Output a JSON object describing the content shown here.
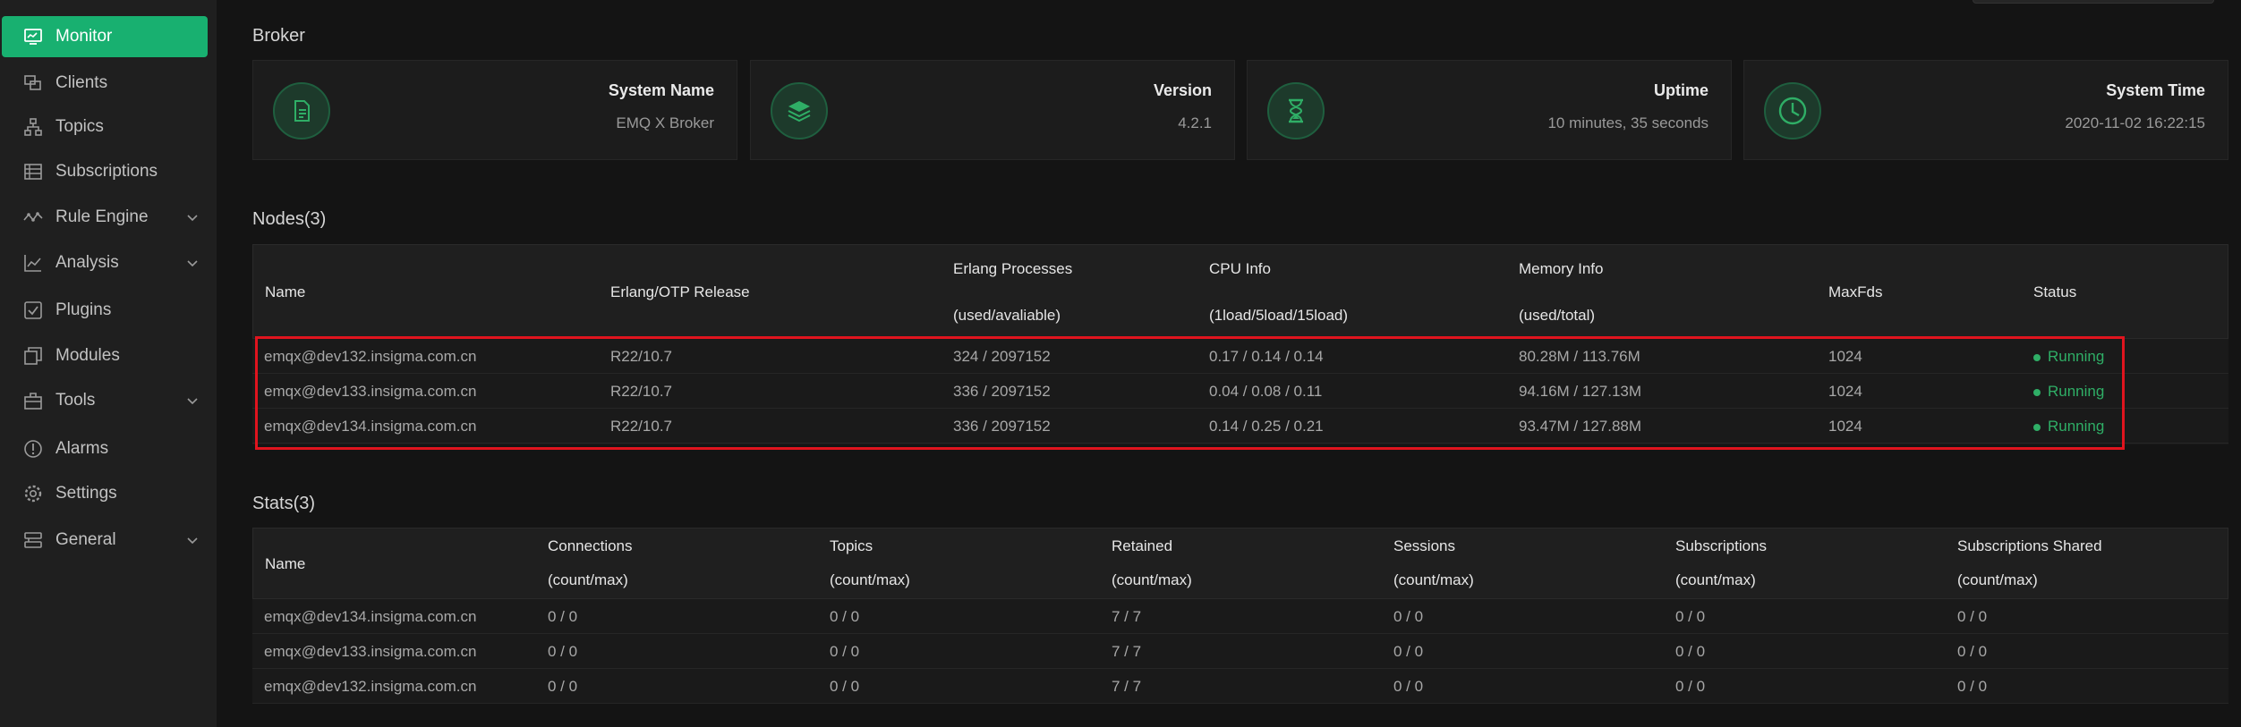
{
  "sidebar": {
    "items": [
      {
        "label": "Monitor",
        "icon": "monitor-icon",
        "active": true
      },
      {
        "label": "Clients",
        "icon": "clients-icon"
      },
      {
        "label": "Topics",
        "icon": "topics-icon"
      },
      {
        "label": "Subscriptions",
        "icon": "subscriptions-icon"
      },
      {
        "label": "Rule Engine",
        "icon": "rule-engine-icon",
        "expandable": true
      },
      {
        "label": "Analysis",
        "icon": "analysis-icon",
        "expandable": true
      },
      {
        "label": "Plugins",
        "icon": "plugins-icon"
      },
      {
        "label": "Modules",
        "icon": "modules-icon"
      },
      {
        "label": "Tools",
        "icon": "tools-icon",
        "expandable": true
      },
      {
        "label": "Alarms",
        "icon": "alarms-icon"
      },
      {
        "label": "Settings",
        "icon": "settings-icon"
      },
      {
        "label": "General",
        "icon": "general-icon",
        "expandable": true
      }
    ]
  },
  "broker": {
    "title": "Broker",
    "cards": [
      {
        "title": "System Name",
        "value": "EMQ X Broker",
        "icon": "document-icon"
      },
      {
        "title": "Version",
        "value": "4.2.1",
        "icon": "layers-icon"
      },
      {
        "title": "Uptime",
        "value": "10 minutes, 35 seconds",
        "icon": "hourglass-icon"
      },
      {
        "title": "System Time",
        "value": "2020-11-02 16:22:15",
        "icon": "clock-icon"
      }
    ]
  },
  "nodes": {
    "title": "Nodes(3)",
    "headers": {
      "name": "Name",
      "otp": "Erlang/OTP Release",
      "proc1": "Erlang Processes",
      "proc2": "(used/avaliable)",
      "cpu1": "CPU Info",
      "cpu2": "(1load/5load/15load)",
      "mem1": "Memory Info",
      "mem2": "(used/total)",
      "maxfds": "MaxFds",
      "status": "Status"
    },
    "rows": [
      {
        "name": "emqx@dev132.insigma.com.cn",
        "otp": "R22/10.7",
        "proc": "324 / 2097152",
        "cpu": "0.17 / 0.14 / 0.14",
        "mem": "80.28M / 113.76M",
        "maxfds": "1024",
        "status": "Running"
      },
      {
        "name": "emqx@dev133.insigma.com.cn",
        "otp": "R22/10.7",
        "proc": "336 / 2097152",
        "cpu": "0.04 / 0.08 / 0.11",
        "mem": "94.16M / 127.13M",
        "maxfds": "1024",
        "status": "Running"
      },
      {
        "name": "emqx@dev134.insigma.com.cn",
        "otp": "R22/10.7",
        "proc": "336 / 2097152",
        "cpu": "0.14 / 0.25 / 0.21",
        "mem": "93.47M / 127.88M",
        "maxfds": "1024",
        "status": "Running"
      }
    ]
  },
  "stats": {
    "title": "Stats(3)",
    "headers": {
      "name": "Name",
      "conn1": "Connections",
      "conn2": "(count/max)",
      "topics1": "Topics",
      "topics2": "(count/max)",
      "ret1": "Retained",
      "ret2": "(count/max)",
      "sess1": "Sessions",
      "sess2": "(count/max)",
      "subs1": "Subscriptions",
      "subs2": "(count/max)",
      "shared1": "Subscriptions Shared",
      "shared2": "(count/max)"
    },
    "rows": [
      {
        "name": "emqx@dev134.insigma.com.cn",
        "conn": "0 / 0",
        "topics": "0 / 0",
        "retained": "7 / 7",
        "sessions": "0 / 0",
        "subs": "0 / 0",
        "shared": "0 / 0"
      },
      {
        "name": "emqx@dev133.insigma.com.cn",
        "conn": "0 / 0",
        "topics": "0 / 0",
        "retained": "7 / 7",
        "sessions": "0 / 0",
        "subs": "0 / 0",
        "shared": "0 / 0"
      },
      {
        "name": "emqx@dev132.insigma.com.cn",
        "conn": "0 / 0",
        "topics": "0 / 0",
        "retained": "7 / 7",
        "sessions": "0 / 0",
        "subs": "0 / 0",
        "shared": "0 / 0"
      }
    ]
  },
  "colors": {
    "accent": "#18b070",
    "status_running": "#2fae66",
    "highlight": "#e0141e"
  }
}
